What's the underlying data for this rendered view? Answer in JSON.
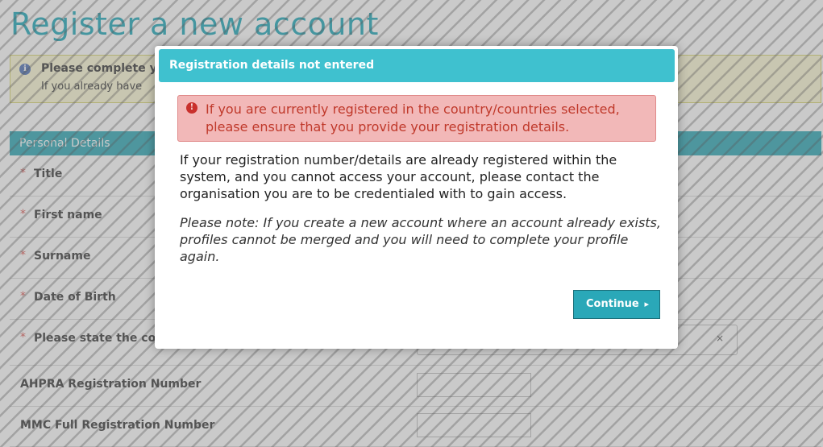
{
  "page": {
    "title": "Register a new account"
  },
  "info": {
    "line1": "Please complete y",
    "line2": "If you already have",
    "icon": "info-circle-icon"
  },
  "personal": {
    "header": "Personal Details",
    "fields": {
      "title": "Title",
      "first_name": "First name",
      "surname": "Surname",
      "dob": "Date of Birth",
      "country": "Please state the co",
      "ahpra": "AHPRA Registration Number",
      "mmc": "MMC Full Registration Number"
    },
    "required_mark": "*",
    "select_clear": "×"
  },
  "modal": {
    "title": "Registration details not entered",
    "alert_icon": "exclamation-circle-icon",
    "alert_text": "If you are currently registered in the country/countries selected, please ensure that you provide your registration details.",
    "body": "If your registration number/details are already registered within the system, and you cannot access your account, please contact the organisation you are to be credentialed with to gain access.",
    "note": "Please note: If you create a new account where an account already exists, profiles cannot be merged and you will need to complete your profile again.",
    "continue_label": "Continue",
    "continue_icon": "chevron-right-icon"
  },
  "colors": {
    "accent": "#3fc1cf",
    "panel_header": "#2aa6b4",
    "alert_bg": "#f2b8b8",
    "alert_text": "#c0392b",
    "info_bg": "#fcf8d4"
  }
}
